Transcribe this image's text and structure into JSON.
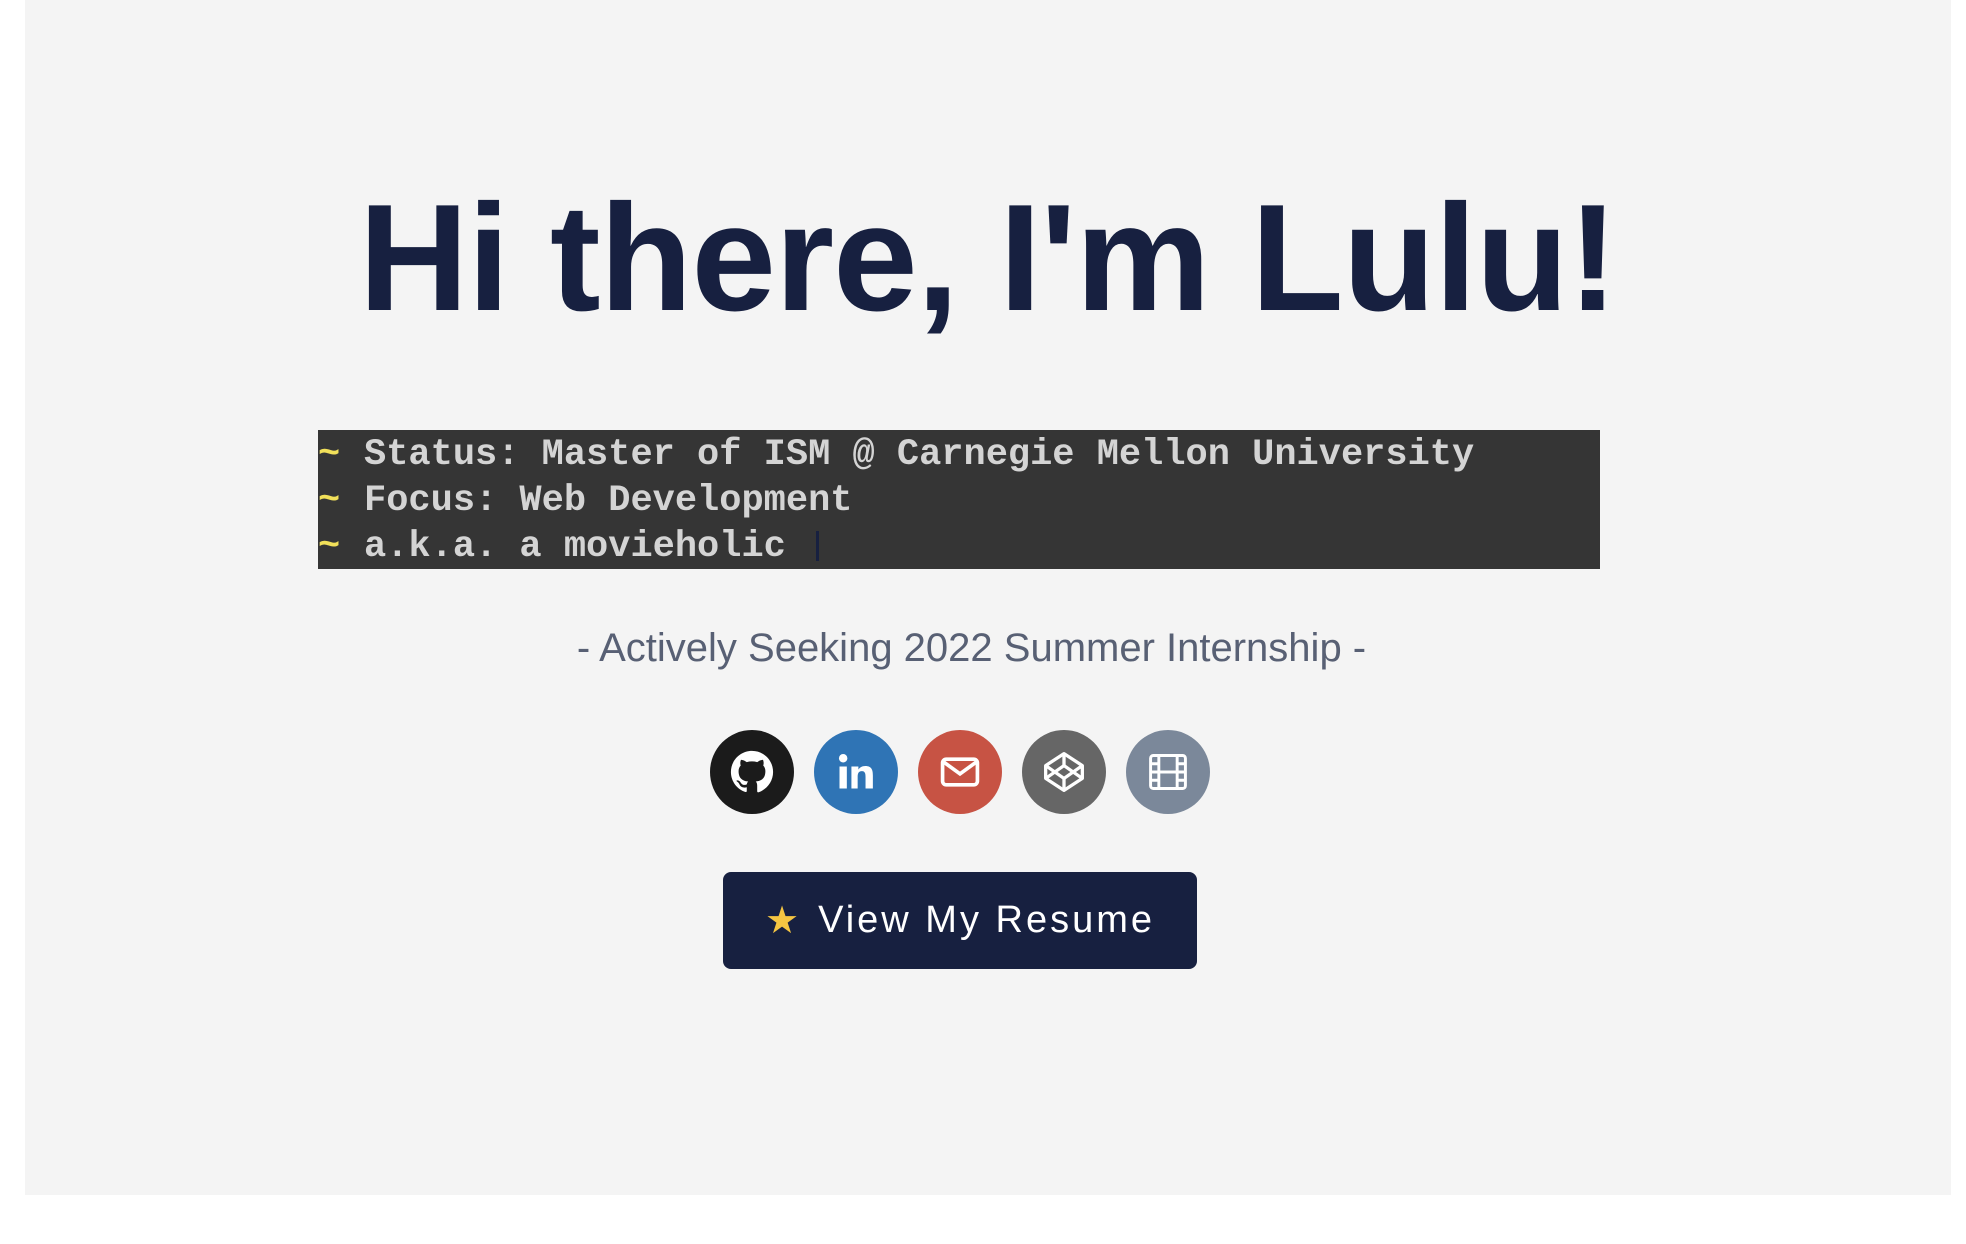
{
  "hero": {
    "title": "Hi there, I'm Lulu!"
  },
  "terminal": {
    "prompt": "~",
    "lines": [
      "Status: Master of ISM @ Carnegie Mellon University",
      "Focus: Web Development",
      "a.k.a. a movieholic"
    ]
  },
  "subtitle": "- Actively Seeking 2022 Summer Internship -",
  "socials": [
    {
      "icon": "github-icon",
      "color": "#1b1b1b"
    },
    {
      "icon": "linkedin-icon",
      "color": "#2f74b5"
    },
    {
      "icon": "mail-icon",
      "color": "#c75344"
    },
    {
      "icon": "codepen-icon",
      "color": "#666666"
    },
    {
      "icon": "film-icon",
      "color": "#7b889a"
    }
  ],
  "resume_button": {
    "icon": "star-icon",
    "label": "View My Resume"
  },
  "colors": {
    "page_background": "#f4f4f4",
    "primary_navy": "#172040",
    "terminal_background": "#353535",
    "terminal_prompt": "#f1e05a"
  }
}
